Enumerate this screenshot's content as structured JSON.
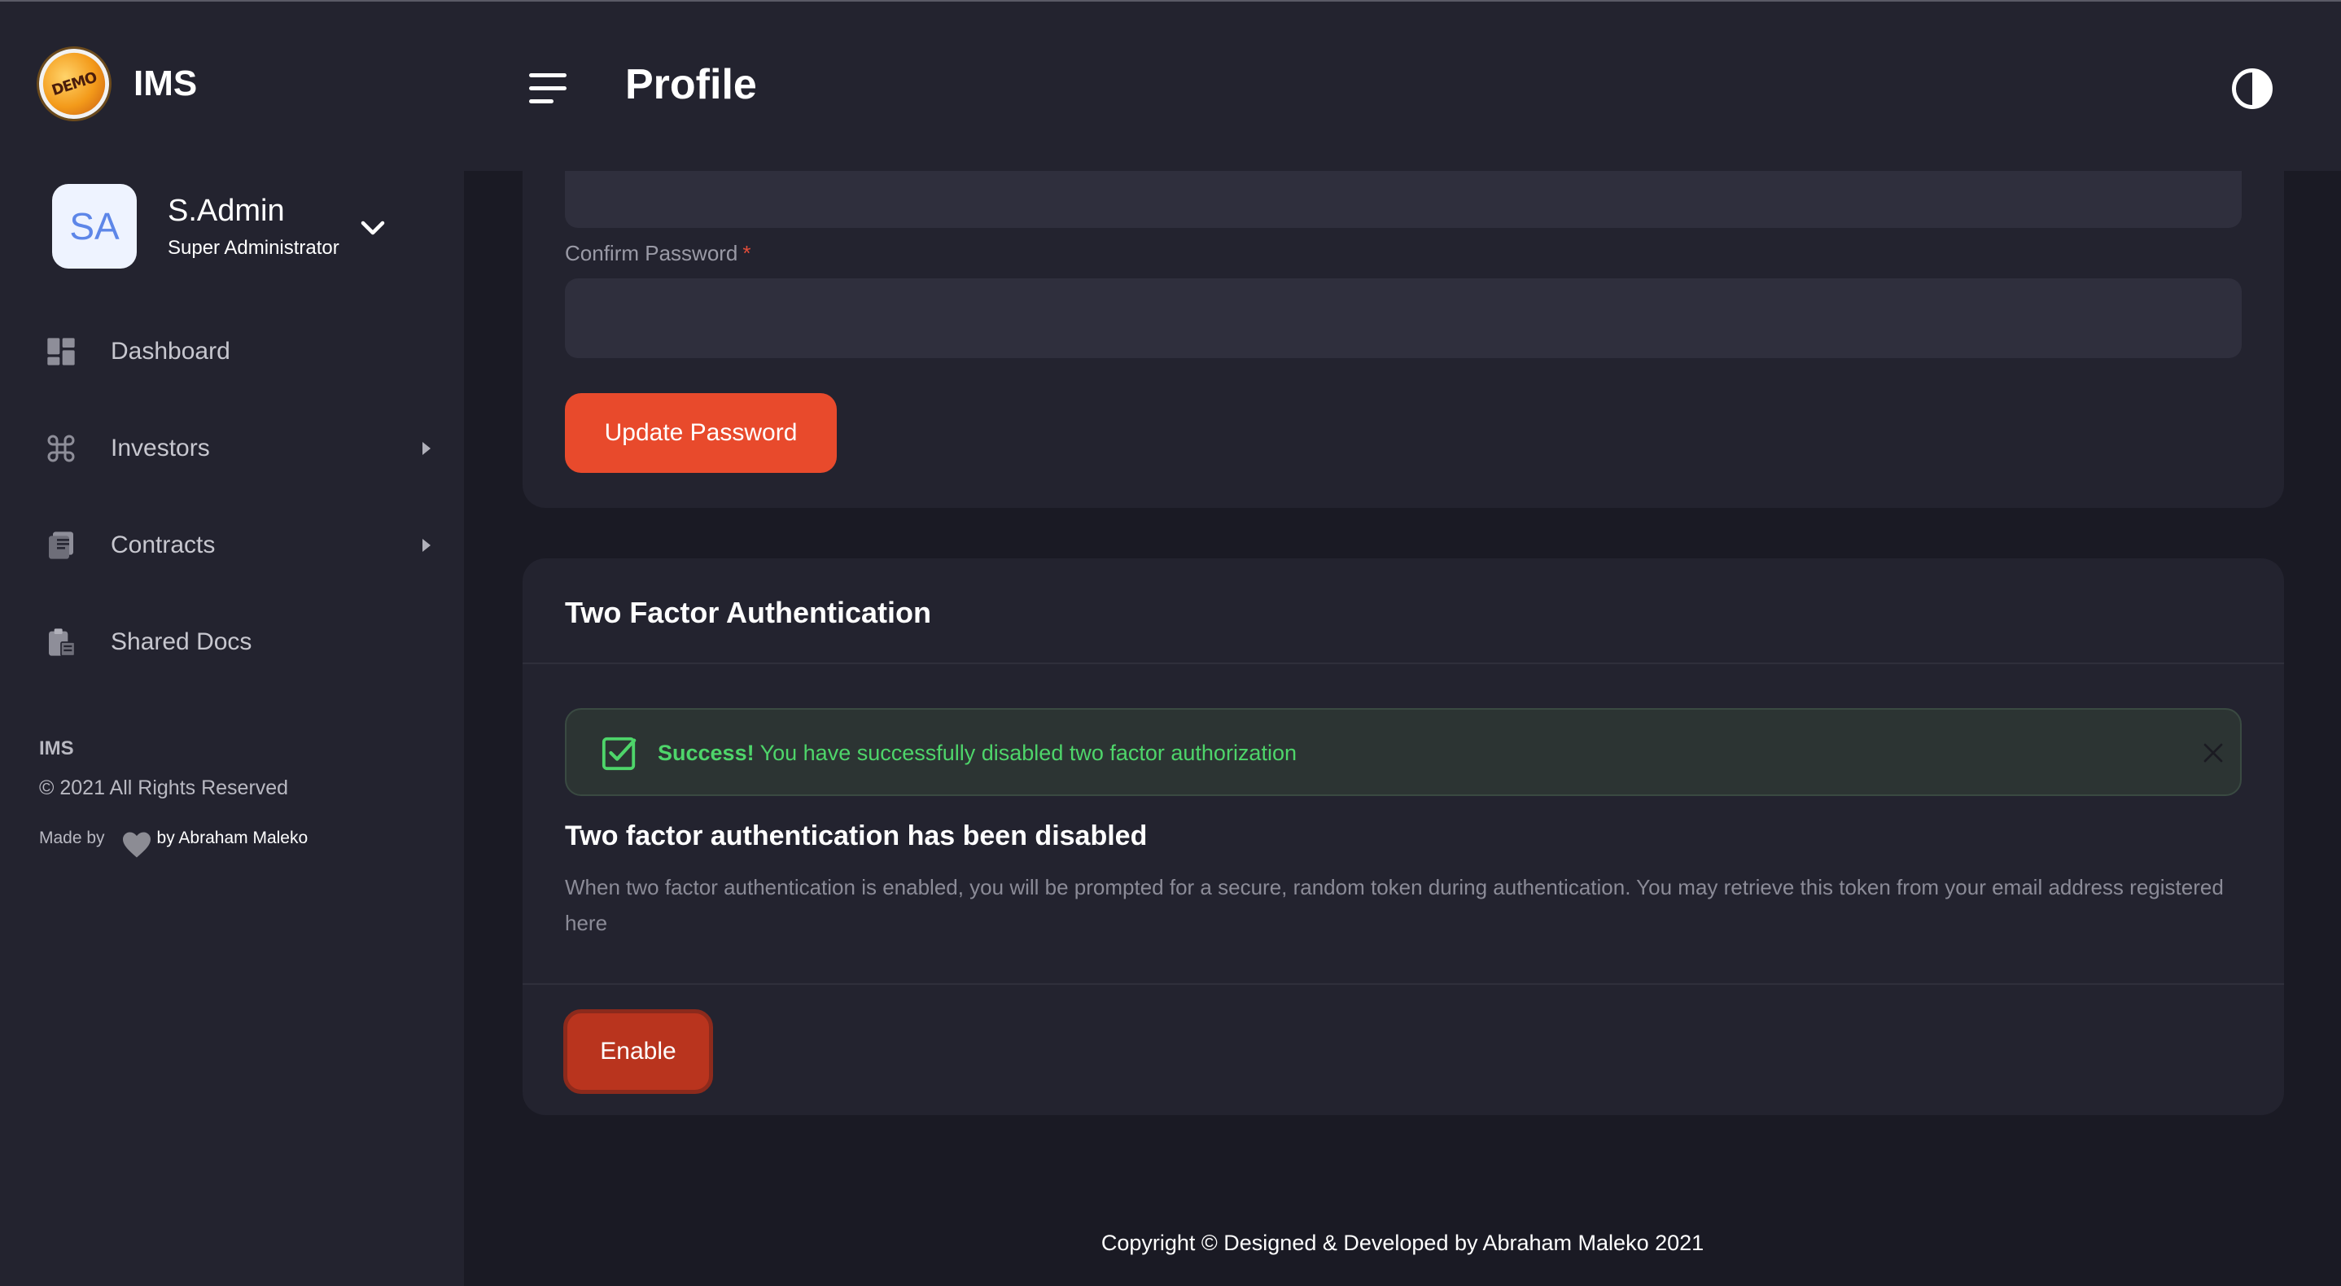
{
  "app": {
    "name": "IMS",
    "logo_text": "DEMO"
  },
  "header": {
    "title": "Profile"
  },
  "user": {
    "initials": "SA",
    "name": "S.Admin",
    "role": "Super Administrator"
  },
  "sidebar": {
    "items": [
      {
        "label": "Dashboard",
        "icon": "dashboard-icon",
        "has_submenu": false
      },
      {
        "label": "Investors",
        "icon": "command-icon",
        "has_submenu": true
      },
      {
        "label": "Contracts",
        "icon": "documents-icon",
        "has_submenu": true
      },
      {
        "label": "Shared Docs",
        "icon": "clipboard-icon",
        "has_submenu": false
      }
    ],
    "footer": {
      "title": "IMS",
      "rights": "© 2021 All Rights Reserved",
      "made_by": "Made by",
      "author": "by Abraham Maleko"
    }
  },
  "password_form": {
    "confirm_label": "Confirm Password",
    "required_marker": "*",
    "confirm_value": "",
    "update_button": "Update Password"
  },
  "two_factor": {
    "title": "Two Factor Authentication",
    "alert": {
      "strong": "Success!",
      "message": "You have successfully disabled two factor authorization",
      "color": "#4ed56a"
    },
    "status_heading": "Two factor authentication has been disabled",
    "description": "When two factor authentication is enabled, you will be prompted for a secure, random token during authentication. You may retrieve this token from your email address registered here",
    "enable_button": "Enable"
  },
  "footer": {
    "copyright": "Copyright © Designed & Developed by Abraham Maleko 2021"
  },
  "colors": {
    "background": "#1a1a24",
    "panel": "#23232f",
    "accent": "#e84a2c",
    "success": "#4ed56a"
  }
}
